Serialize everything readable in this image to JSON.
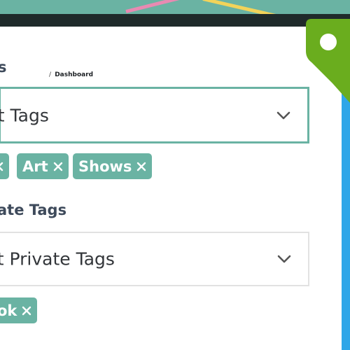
{
  "public_tags": {
    "title": "s",
    "breadcrumb": {
      "separator": "/",
      "label": "Dashboard"
    },
    "select_placeholder": "ct Tags",
    "chips": [
      "Art",
      "Shows"
    ]
  },
  "private_tags": {
    "title": "ate Tags",
    "select_placeholder": "ct Private Tags",
    "chips": [
      "ok"
    ]
  },
  "colors": {
    "accent": "#6ab3a3",
    "tag_badge": "#6aad1e",
    "frame_blue": "#2fa6e8"
  },
  "icons": {
    "chevron": "chevron-down-icon",
    "remove": "close-icon",
    "tag": "tag-icon"
  }
}
